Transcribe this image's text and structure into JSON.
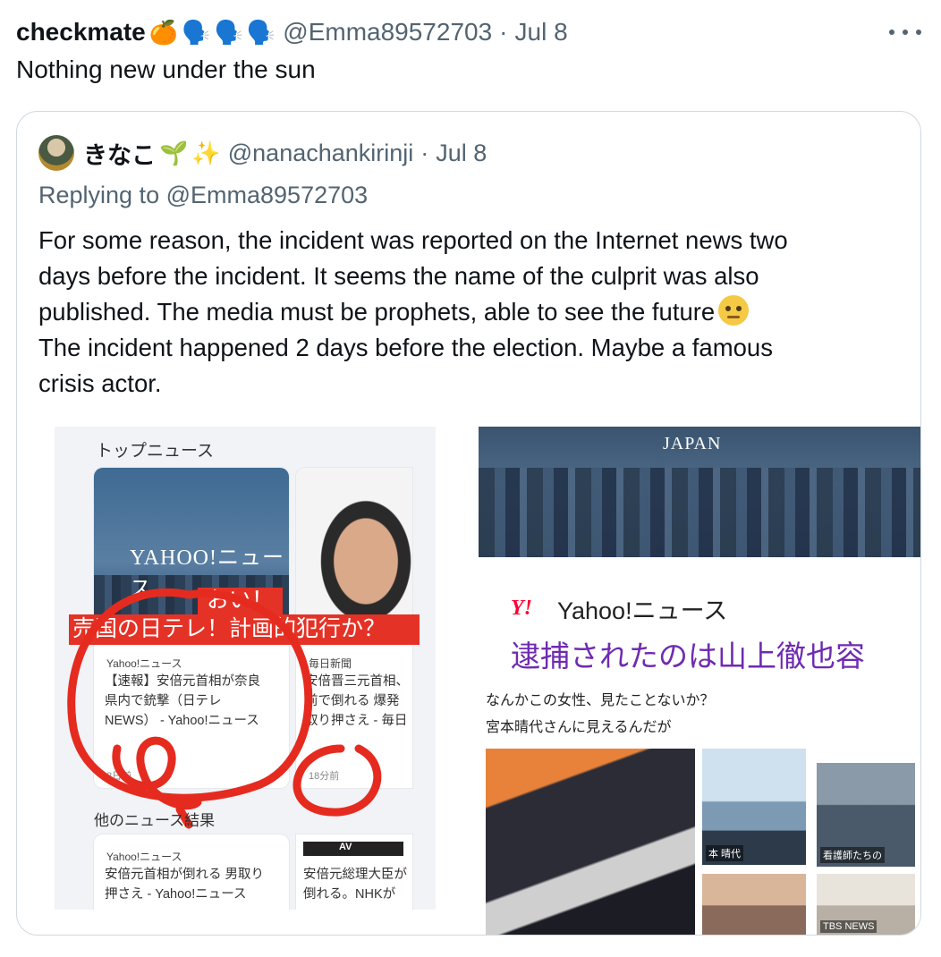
{
  "tweet": {
    "display_name": "checkmate",
    "emojis": [
      "🍊",
      "🗣️",
      "🗣️",
      "🗣️"
    ],
    "handle": "@Emma89572703",
    "separator": "·",
    "date": "Jul 8",
    "text": "Nothing new under the sun"
  },
  "quote": {
    "display_name": "きなこ",
    "emojis": [
      "🌱",
      "✨"
    ],
    "handle": "@nanachankirinji",
    "separator": "·",
    "date": "Jul 8",
    "replying_prefix": "Replying to",
    "replying_handle": "@Emma89572703",
    "body_lines": [
      "For some reason, the incident was reported on the Internet news two",
      "days before the incident. It seems the name of the culprit was also",
      "published. The media must be prophets, able to see the future",
      "The incident happened 2 days before the election. Maybe a famous",
      "crisis actor."
    ]
  },
  "media": {
    "left": {
      "heading": "トップニュース",
      "card1_logo": "YAHOO!ニュース",
      "card1_source": "Yahoo!ニュース",
      "card1_headline": [
        "【速報】安倍元首相が奈良",
        "県内で銃撃（日テレ",
        "NEWS） - Yahoo!ニュース"
      ],
      "card1_time": "2日前",
      "card2_source": "毎日新聞",
      "card2_headline": [
        "安倍晋三元首相、",
        "前で倒れる 爆発",
        "取り押さえ - 毎日"
      ],
      "card2_time": "18分前",
      "overlay_oi": "おい！",
      "overlay_banner": "売国の日テレ！計画的犯行か？",
      "other_heading": "他のニュース結果",
      "card3_source": "Yahoo!ニュース",
      "card3_headline": [
        "安倍元首相が倒れる 男取り",
        "押さえ - Yahoo!ニュース"
      ],
      "card4_badge": "AV",
      "card4_headline": [
        "安倍元総理大臣が",
        "倒れる。NHKが"
      ]
    },
    "right_top": {
      "banner_text": "JAPAN",
      "y_mark": "Y!",
      "source_label": "Yahoo!ニュース",
      "headline": "逮捕されたのは山上徹也容"
    },
    "right_bottom": {
      "line1": "なんかこの女性、見たことないか？",
      "line2": "宮本晴代さんに見えるんだが",
      "thumb_caption1": "本 晴代",
      "thumb_caption2": "看護師たちの",
      "thumb_caption3": "TBS NEWS"
    }
  }
}
